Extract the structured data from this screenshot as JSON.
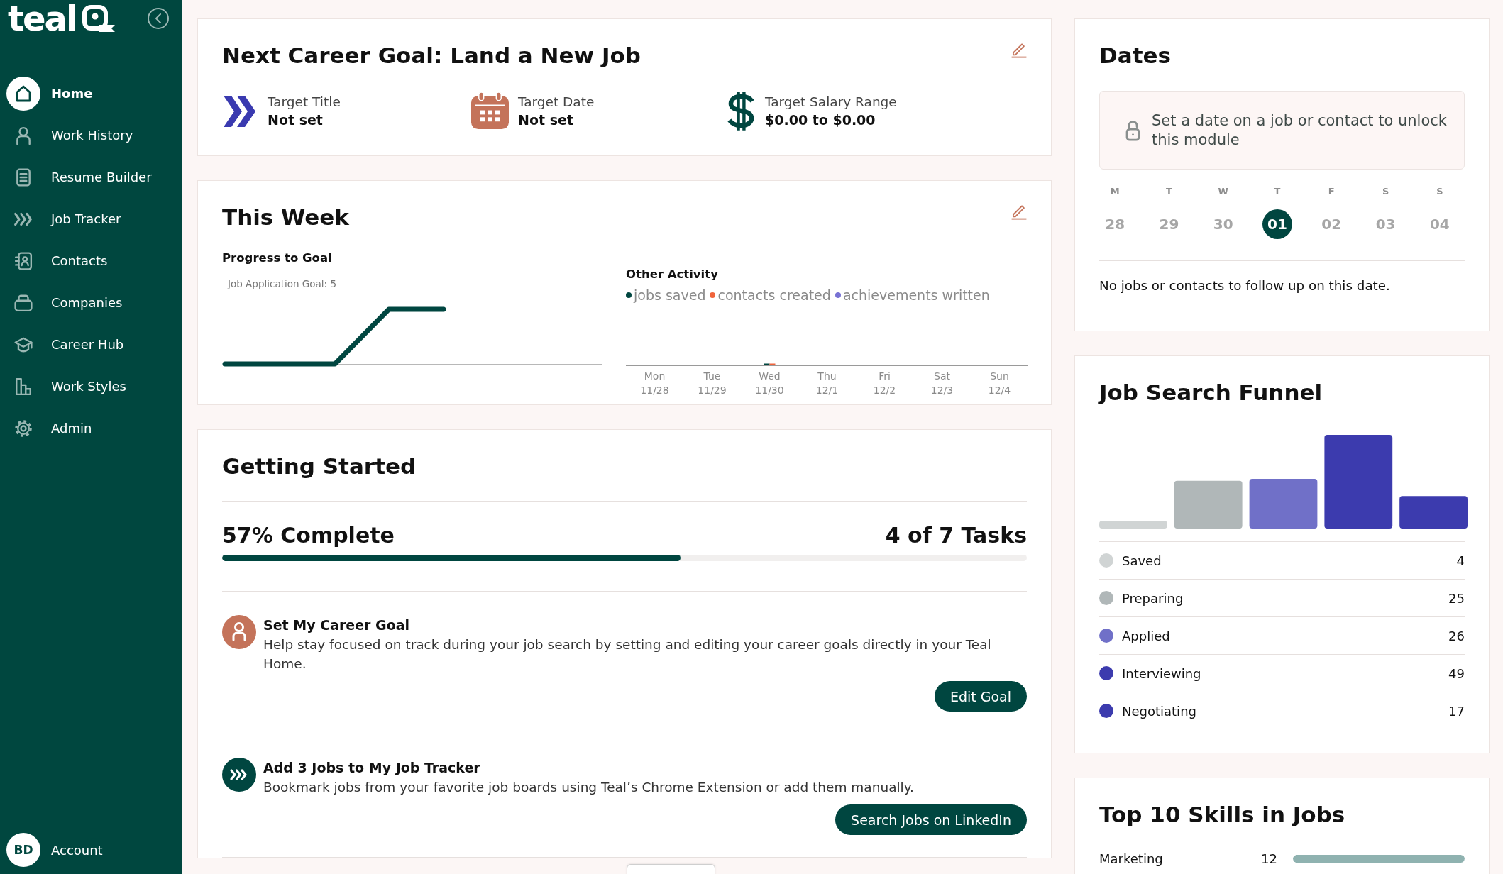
{
  "sidebar": {
    "logo_text": "teal",
    "nav_items": [
      {
        "label": "Home",
        "selected": true
      },
      {
        "label": "Work History",
        "selected": false
      },
      {
        "label": "Resume Builder",
        "selected": false
      },
      {
        "label": "Job Tracker",
        "selected": false
      },
      {
        "label": "Contacts",
        "selected": false
      },
      {
        "label": "Companies",
        "selected": false
      },
      {
        "label": "Career Hub",
        "selected": false
      },
      {
        "label": "Work Styles",
        "selected": false
      },
      {
        "label": "Admin",
        "selected": false
      }
    ],
    "account": {
      "initials": "BD",
      "label": "Account"
    }
  },
  "career_goal": {
    "title": "Next Career Goal: Land a New Job",
    "targets": [
      {
        "label": "Target Title",
        "value": "Not set"
      },
      {
        "label": "Target Date",
        "value": "Not set"
      },
      {
        "label": "Target Salary Range",
        "value": "$0.00 to $0.00"
      }
    ]
  },
  "this_week": {
    "title": "This Week",
    "progress": {
      "title": "Progress to Goal",
      "goal_label": "Job Application Goal: 5"
    },
    "other_activity": {
      "title": "Other Activity",
      "legend": [
        {
          "name": "jobs saved",
          "color": "#004640"
        },
        {
          "name": "contacts created",
          "color": "#f0643c"
        },
        {
          "name": "achievements written",
          "color": "#7872d4"
        }
      ],
      "day_labels": [
        "Mon 11/28",
        "Tue 11/29",
        "Wed 11/30",
        "Thu 12/1",
        "Fri 12/2",
        "Sat 12/3",
        "Sun 12/4"
      ]
    }
  },
  "getting_started": {
    "title": "Getting Started",
    "completion": "57% Complete",
    "tasks_count": "4 of 7 Tasks",
    "level": 0.57,
    "tasks": [
      {
        "title": "Set My Career Goal",
        "description": "Help stay focused on track during your job search by setting and editing your career goals directly in your Teal Home.",
        "button": "Edit Goal"
      },
      {
        "title": "Add 3 Jobs to My Job Tracker",
        "description": "Bookmark jobs from your favorite job boards using Teal’s Chrome Extension or add them manually.",
        "button": "Search Jobs on LinkedIn"
      }
    ]
  },
  "dates": {
    "title": "Dates",
    "locked_message": "Set a date on a job or contact to unlock this module",
    "days": [
      {
        "weekday": "M",
        "date": "28",
        "selected": false
      },
      {
        "weekday": "T",
        "date": "29",
        "selected": false
      },
      {
        "weekday": "W",
        "date": "30",
        "selected": false
      },
      {
        "weekday": "T",
        "date": "01",
        "selected": true
      },
      {
        "weekday": "F",
        "date": "02",
        "selected": false
      },
      {
        "weekday": "S",
        "date": "03",
        "selected": false
      },
      {
        "weekday": "S",
        "date": "04",
        "selected": false
      }
    ],
    "empty_message": "No jobs or contacts to follow up on this date."
  },
  "funnel": {
    "title": "Job Search Funnel",
    "stages": [
      {
        "name": "Saved",
        "count": "4",
        "color": "#d0d4d4"
      },
      {
        "name": "Preparing",
        "count": "25",
        "color": "#b0b7b8"
      },
      {
        "name": "Applied",
        "count": "26",
        "color": "#7070c8"
      },
      {
        "name": "Interviewing",
        "count": "49",
        "color": "#3c3bae"
      },
      {
        "name": "Negotiating",
        "count": "17",
        "color": "#3c3bae"
      }
    ]
  },
  "skills": {
    "title": "Top 10 Skills in Jobs",
    "items": [
      {
        "name": "Marketing",
        "count": "12",
        "level": 1.0
      }
    ]
  }
}
